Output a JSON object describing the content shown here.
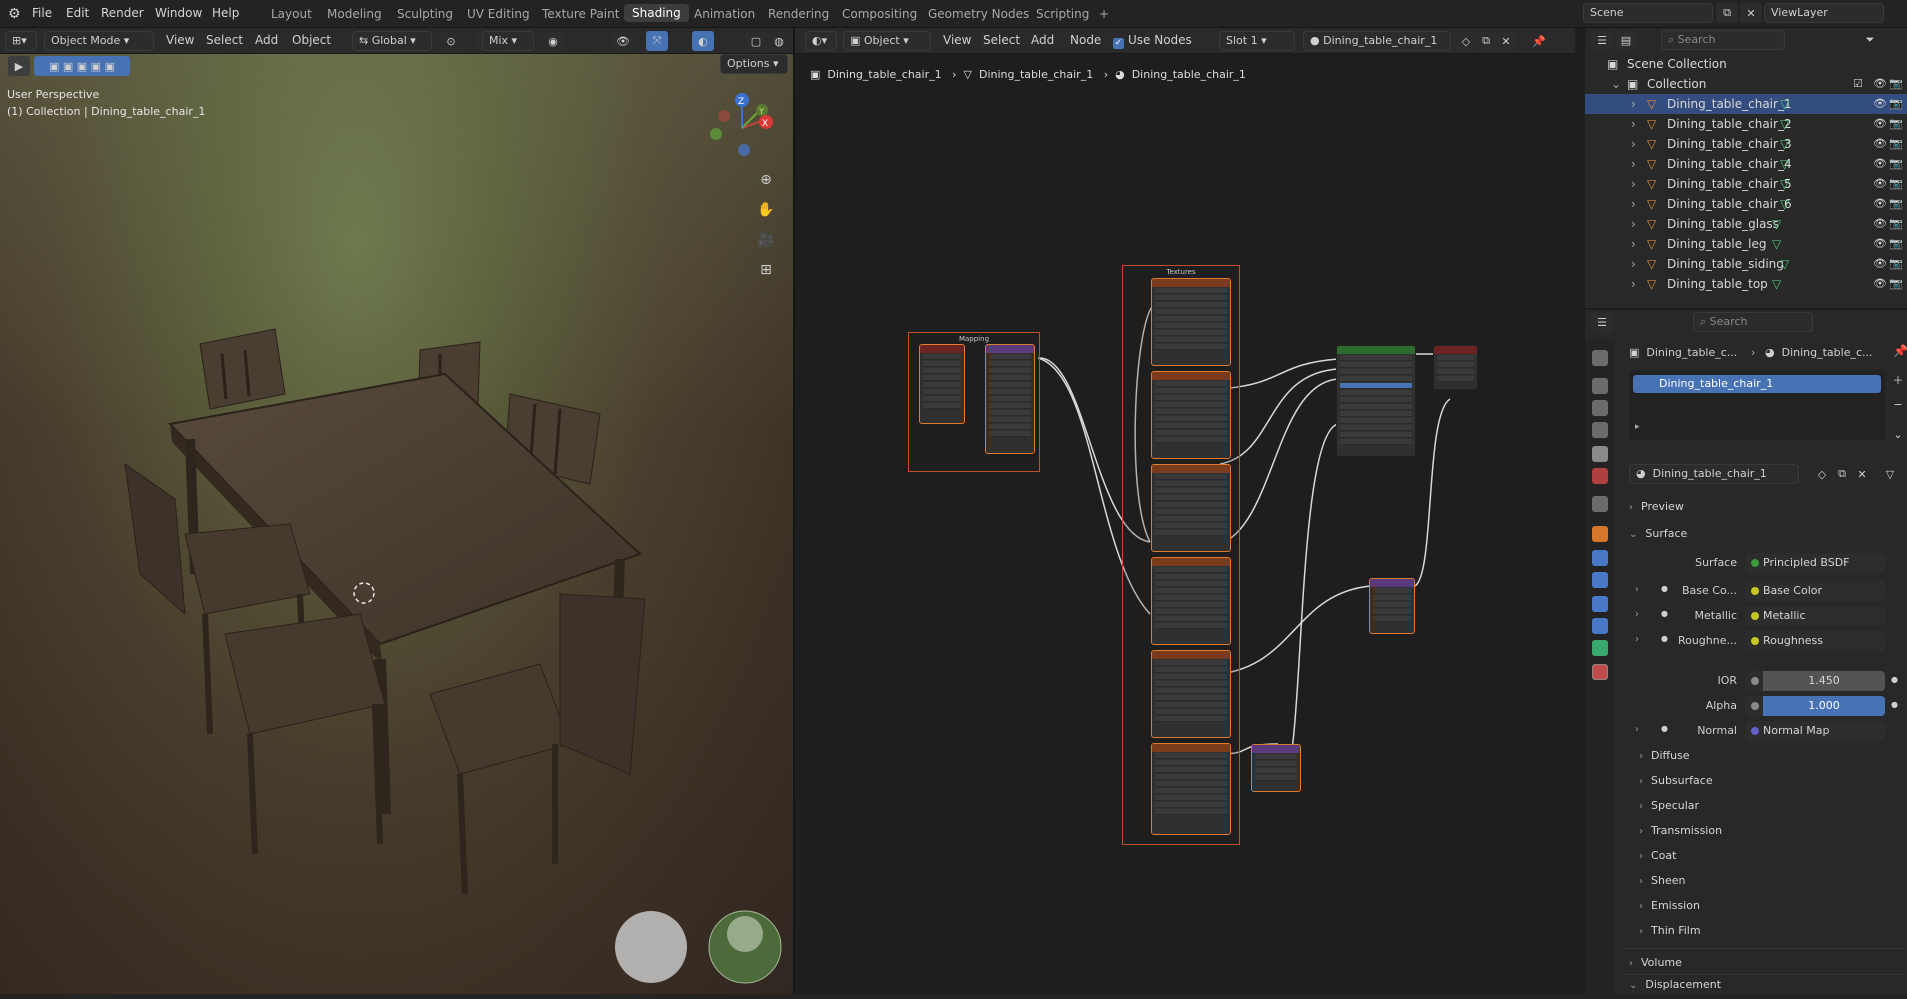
{
  "menu": {
    "file": "File",
    "edit": "Edit",
    "render": "Render",
    "window": "Window",
    "help": "Help"
  },
  "workspaces": [
    "Layout",
    "Modeling",
    "Sculpting",
    "UV Editing",
    "Texture Paint",
    "Shading",
    "Animation",
    "Rendering",
    "Compositing",
    "Geometry Nodes",
    "Scripting"
  ],
  "workspace_add": "+",
  "scene": {
    "label": "Scene",
    "viewlayer": "ViewLayer"
  },
  "viewport_header": {
    "mode": "Object Mode",
    "view": "View",
    "select": "Select",
    "add": "Add",
    "object": "Object",
    "orientation": "Global",
    "blend": "Mix",
    "options": "Options"
  },
  "viewport_info": {
    "perspective": "User Perspective",
    "collection": "(1) Collection | Dining_table_chair_1"
  },
  "node_header": {
    "type": "Object",
    "view": "View",
    "select": "Select",
    "add": "Add",
    "node": "Node",
    "use_nodes": "Use Nodes",
    "slot": "Slot 1",
    "material": "Dining_table_chair_1"
  },
  "breadcrumb": [
    "Dining_table_chair_1",
    "Dining_table_chair_1",
    "Dining_table_chair_1"
  ],
  "frames": {
    "mapping": "Mapping",
    "textures": "Textures"
  },
  "outliner": {
    "search_placeholder": "Search",
    "scene_collection": "Scene Collection",
    "collection": "Collection",
    "items": [
      "Dining_table_chair_1",
      "Dining_table_chair_2",
      "Dining_table_chair_3",
      "Dining_table_chair_4",
      "Dining_table_chair_5",
      "Dining_table_chair_6",
      "Dining_table_glass",
      "Dining_table_leg",
      "Dining_table_siding",
      "Dining_table_top"
    ]
  },
  "properties": {
    "search_placeholder": "Search",
    "breadcrumb_object": "Dining_table_c...",
    "breadcrumb_material": "Dining_table_c...",
    "slot_item": "Dining_table_chair_1",
    "material_name": "Dining_table_chair_1",
    "preview": "Preview",
    "surface": "Surface",
    "surface_label": "Surface",
    "surface_value": "Principled BSDF",
    "rows": [
      {
        "label": "Base Co...",
        "value": "Base Color",
        "color": "#c7c729"
      },
      {
        "label": "Metallic",
        "value": "Metallic",
        "color": "#c7c729"
      },
      {
        "label": "Roughne...",
        "value": "Roughness",
        "color": "#c7c729"
      }
    ],
    "ior_label": "IOR",
    "ior_value": "1.450",
    "alpha_label": "Alpha",
    "alpha_value": "1.000",
    "normal_label": "Normal",
    "normal_value": "Normal Map",
    "subsections": [
      "Diffuse",
      "Subsurface",
      "Specular",
      "Transmission",
      "Coat",
      "Sheen",
      "Emission",
      "Thin Film"
    ],
    "volume": "Volume",
    "displacement": "Displacement"
  },
  "colors": {
    "accent": "#4772b3",
    "selected": "#334d80",
    "frame": "#c0502a"
  }
}
